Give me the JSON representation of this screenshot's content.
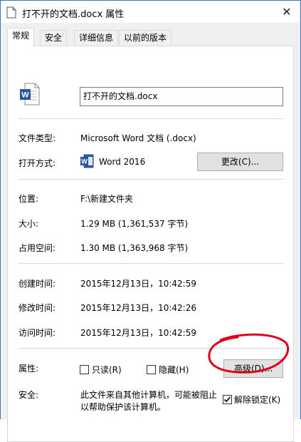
{
  "window": {
    "title": "打不开的文档.docx 属性",
    "close_symbol": "✕"
  },
  "tabs": [
    {
      "label": "常规",
      "active": true
    },
    {
      "label": "安全",
      "active": false
    },
    {
      "label": "详细信息",
      "active": false
    },
    {
      "label": "以前的版本",
      "active": false
    }
  ],
  "general": {
    "filename": "打不开的文档.docx",
    "file_type_label": "文件类型:",
    "file_type_value": "Microsoft Word 文档 (.docx)",
    "open_with_label": "打开方式:",
    "open_with_value": "Word 2016",
    "change_button": "更改(C)...",
    "location_label": "位置:",
    "location_value": "F:\\新建文件夹",
    "size_label": "大小:",
    "size_value": "1.29 MB (1,361,537 字节)",
    "size_on_disk_label": "占用空间:",
    "size_on_disk_value": "1.30 MB (1,363,968 字节)",
    "created_label": "创建时间:",
    "created_value": "2015年12月13日，10:42:59",
    "modified_label": "修改时间:",
    "modified_value": "2015年12月13日，10:42:26",
    "accessed_label": "访问时间:",
    "accessed_value": "2015年12月13日，10:42:59",
    "attributes_label": "属性:",
    "readonly_label": "只读(R)",
    "readonly_checked": false,
    "hidden_label": "隐藏(H)",
    "hidden_checked": false,
    "advanced_button": "高级(D)...",
    "security_label": "安全:",
    "security_text_line1": "此文件来自其他计算机，可能被阻止",
    "security_text_line2": "以帮助保护该计算机。",
    "unblock_label": "解除锁定(K)",
    "unblock_checked": true
  },
  "colors": {
    "word_blue": "#2b579a",
    "annotation_red": "#e0001a",
    "window_border": "#3b73c7"
  }
}
